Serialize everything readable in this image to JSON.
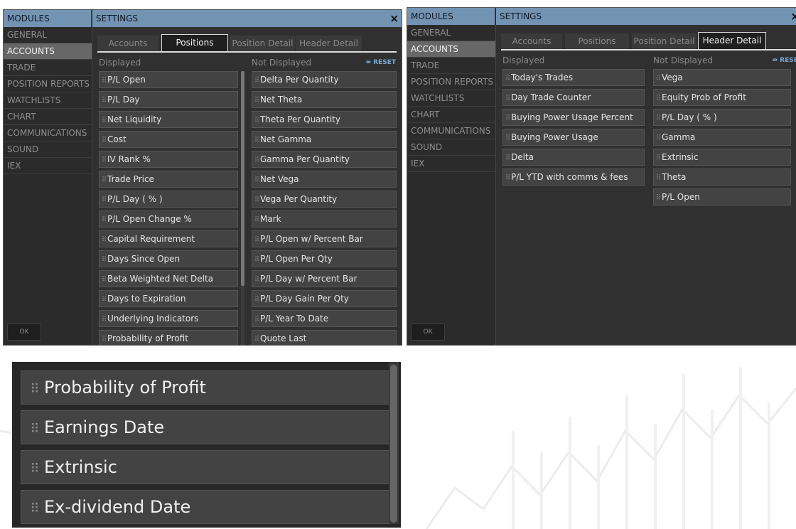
{
  "modules_header": "MODULES",
  "settings_header": "SETTINGS",
  "close_symbol": "×",
  "ok_label": "OK",
  "modules": [
    "GENERAL",
    "ACCOUNTS",
    "TRADE",
    "POSITION REPORTS",
    "WATCHLISTS",
    "CHART",
    "COMMUNICATIONS",
    "SOUND",
    "IEX"
  ],
  "active_module": "ACCOUNTS",
  "tabs": [
    "Accounts",
    "Positions",
    "Position Detail",
    "Header Detail"
  ],
  "displayed_label": "Displayed",
  "not_displayed_label": "Not Displayed",
  "reset_label": "RESET",
  "reset_icon": "⇴",
  "grip_glyph": "⠿",
  "window_positions": {
    "active_tab": "Positions",
    "displayed": [
      "P/L Open",
      "P/L Day",
      "Net Liquidity",
      "Cost",
      "IV Rank %",
      "Trade Price",
      "P/L Day ( % )",
      "P/L Open Change %",
      "Capital Requirement",
      "Days Since Open",
      "Beta Weighted Net Delta",
      "Days to Expiration",
      "Underlying Indicators",
      "Probability of Profit"
    ],
    "not_displayed": [
      "Delta Per Quantity",
      "Net Theta",
      "Theta Per Quantity",
      "Net Gamma",
      "Gamma Per Quantity",
      "Net Vega",
      "Vega Per Quantity",
      "Mark",
      "P/L Open w/ Percent Bar",
      "P/L Open Per Qty",
      "P/L Day w/ Percent Bar",
      "P/L Day Gain Per Qty",
      "P/L Year To Date",
      "Quote Last"
    ]
  },
  "window_header_detail": {
    "active_tab": "Header Detail",
    "displayed": [
      "Today's Trades",
      "Day Trade Counter",
      "Buying Power Usage Percent",
      "Buying Power Usage",
      "Delta",
      "P/L YTD with comms & fees"
    ],
    "not_displayed": [
      "Vega",
      "Equity Prob of Profit",
      "P/L Day ( % )",
      "Gamma",
      "Extrinsic",
      "Theta",
      "P/L Open"
    ]
  },
  "zoomed_items": [
    "Probability of Profit",
    "Earnings Date",
    "Extrinsic",
    "Ex-dividend Date"
  ],
  "colors": {
    "header_bar": "#7393b3",
    "active_module": "#676767",
    "row_bg": "#434343",
    "reset_link": "#79a5d1"
  }
}
